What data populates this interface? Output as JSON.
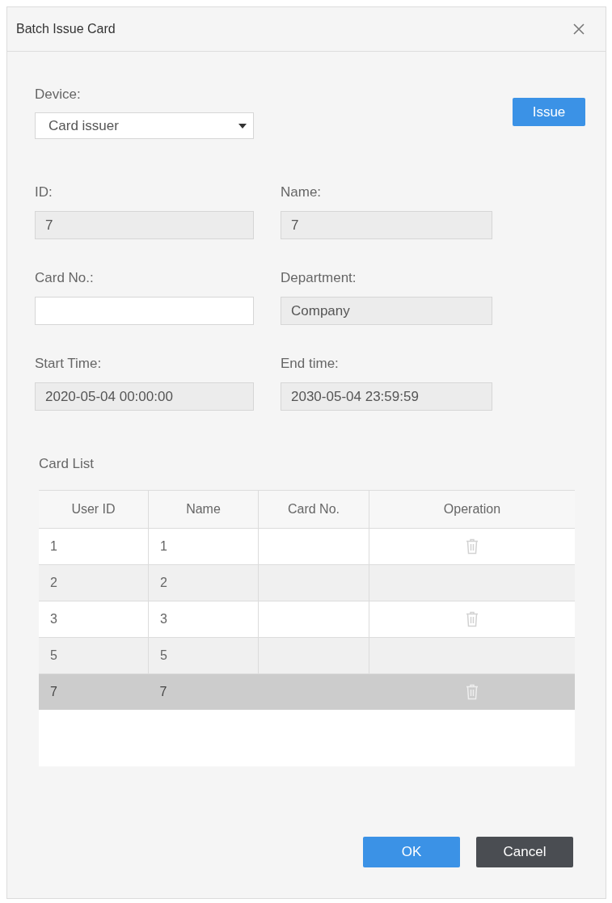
{
  "window": {
    "title": "Batch Issue Card"
  },
  "device": {
    "label": "Device:",
    "value": "Card issuer"
  },
  "issue_button": "Issue",
  "fields": [
    {
      "label": "ID:",
      "value": "7",
      "disabled": true
    },
    {
      "label": "Name:",
      "value": "7",
      "disabled": true
    },
    {
      "label": "Card No.:",
      "disabled": false
    },
    {
      "label": "Department:",
      "value": "Company",
      "disabled": true
    },
    {
      "label": "Start Time:",
      "value": "2020-05-04 00:00:00",
      "disabled": true
    },
    {
      "label": "End time:",
      "value": "2030-05-04 23:59:59",
      "disabled": true
    }
  ],
  "card_list": {
    "title": "Card List",
    "columns": [
      "User ID",
      "Name",
      "Card No.",
      "Operation"
    ],
    "rows": [
      {
        "user_id": "1",
        "name": "1",
        "selected": false,
        "delete_icon": true
      },
      {
        "user_id": "2",
        "name": "2",
        "selected": false,
        "delete_icon": false
      },
      {
        "user_id": "3",
        "name": "3",
        "selected": false,
        "delete_icon": true
      },
      {
        "user_id": "5",
        "name": "5",
        "selected": false,
        "delete_icon": false
      },
      {
        "user_id": "7",
        "name": "7",
        "selected": true,
        "delete_icon": true
      }
    ]
  },
  "buttons": [
    {
      "label": "OK",
      "kind": "primary"
    },
    {
      "label": "Cancel",
      "kind": "secondary"
    }
  ]
}
